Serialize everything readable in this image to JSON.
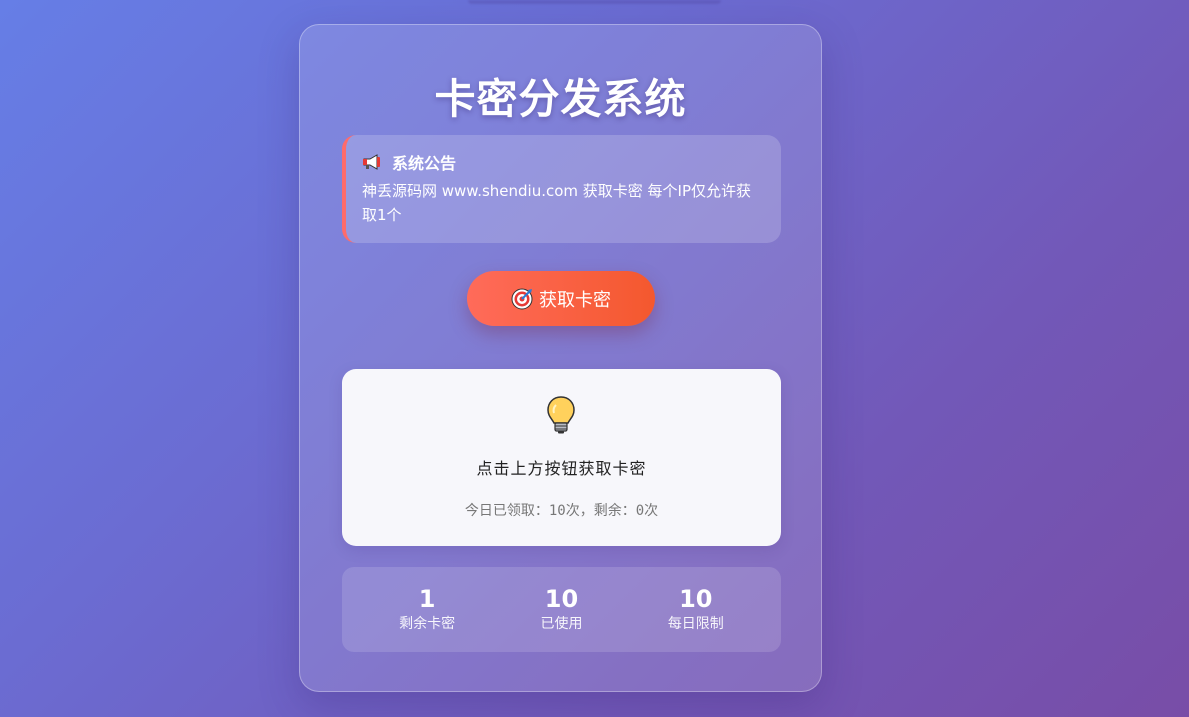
{
  "page": {
    "title": "卡密分发系统"
  },
  "notice": {
    "heading": "系统公告",
    "icon": "megaphone-icon",
    "text": "神丢源码网 www.shendiu.com 获取卡密 每个IP仅允许获取1个"
  },
  "action": {
    "button_label": "获取卡密",
    "button_icon": "target-icon"
  },
  "result": {
    "icon": "lightbulb-icon",
    "message": "点击上方按钮获取卡密",
    "quota": "今日已领取：10次，剩余：0次"
  },
  "stats": [
    {
      "value": "1",
      "label": "剩余卡密"
    },
    {
      "value": "10",
      "label": "已使用"
    },
    {
      "value": "10",
      "label": "每日限制"
    }
  ],
  "colors": {
    "accent_start": "#ff6b5a",
    "accent_end": "#f4582e",
    "notice_border": "#ff6b6b",
    "background_start": "#667ee6",
    "background_end": "#784da7"
  }
}
